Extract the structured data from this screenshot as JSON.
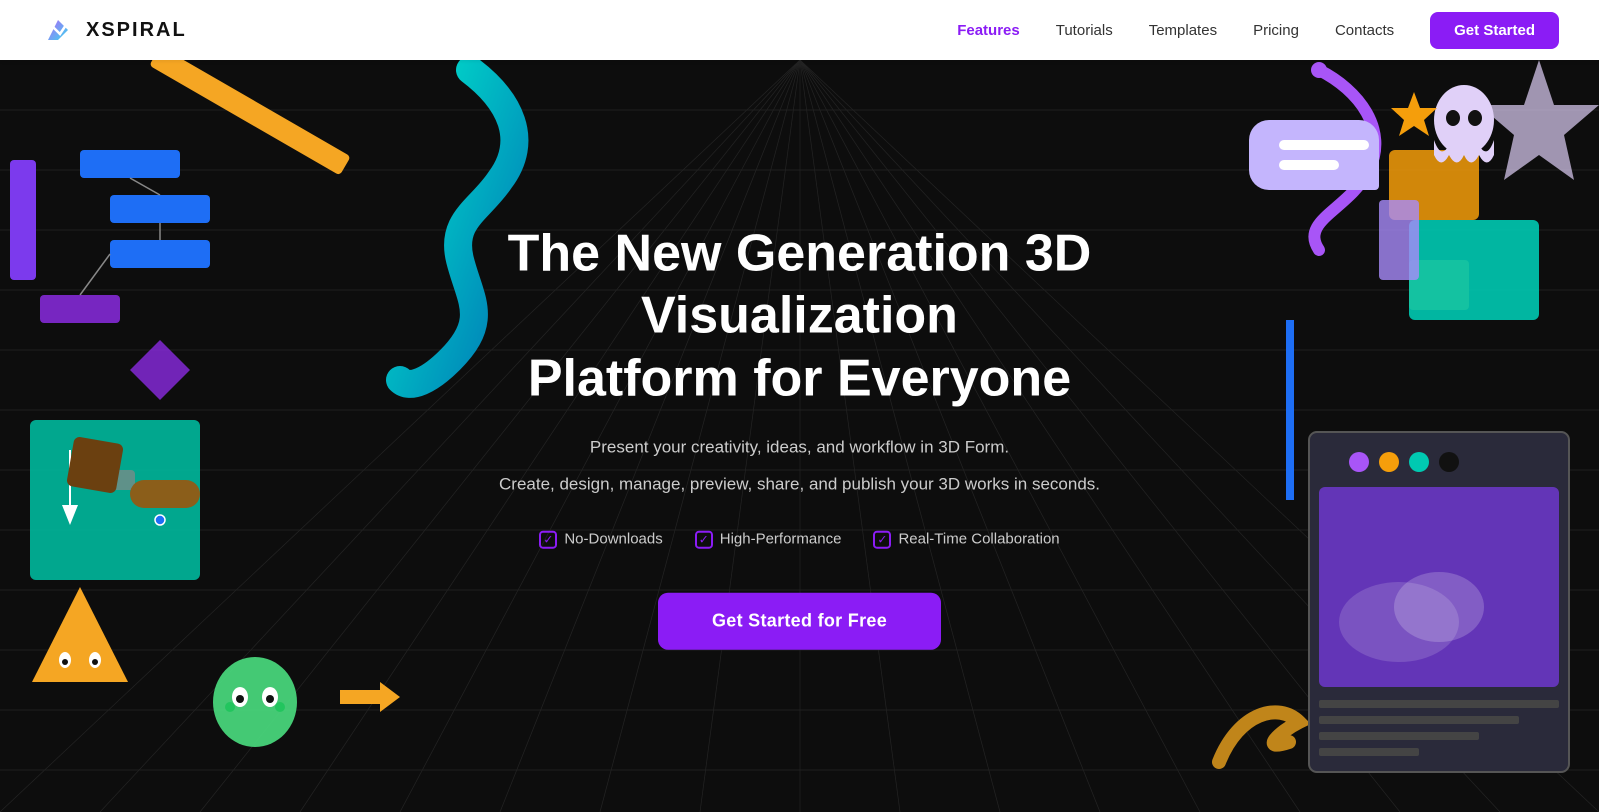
{
  "nav": {
    "logo_text": "XSPIRAL",
    "links": [
      {
        "label": "Features",
        "active": true
      },
      {
        "label": "Tutorials",
        "active": false
      },
      {
        "label": "Templates",
        "active": false
      },
      {
        "label": "Pricing",
        "active": false
      },
      {
        "label": "Contacts",
        "active": false
      }
    ],
    "cta": "Get Started"
  },
  "hero": {
    "title_line1": "The New Generation 3D Visualization",
    "title_line2": "Platform for Everyone",
    "subtitle1": "Present your creativity, ideas, and workflow in 3D Form.",
    "subtitle2": "Create, design, manage, preview, share, and publish your 3D works in seconds.",
    "badge1": "No-Downloads",
    "badge2": "High-Performance",
    "badge3": "Real-Time Collaboration",
    "cta": "Get Started for Free"
  },
  "colors": {
    "purple": "#8b1cf5",
    "teal": "#00c9b1",
    "yellow": "#f5a623",
    "bg": "#0d0d0d"
  }
}
